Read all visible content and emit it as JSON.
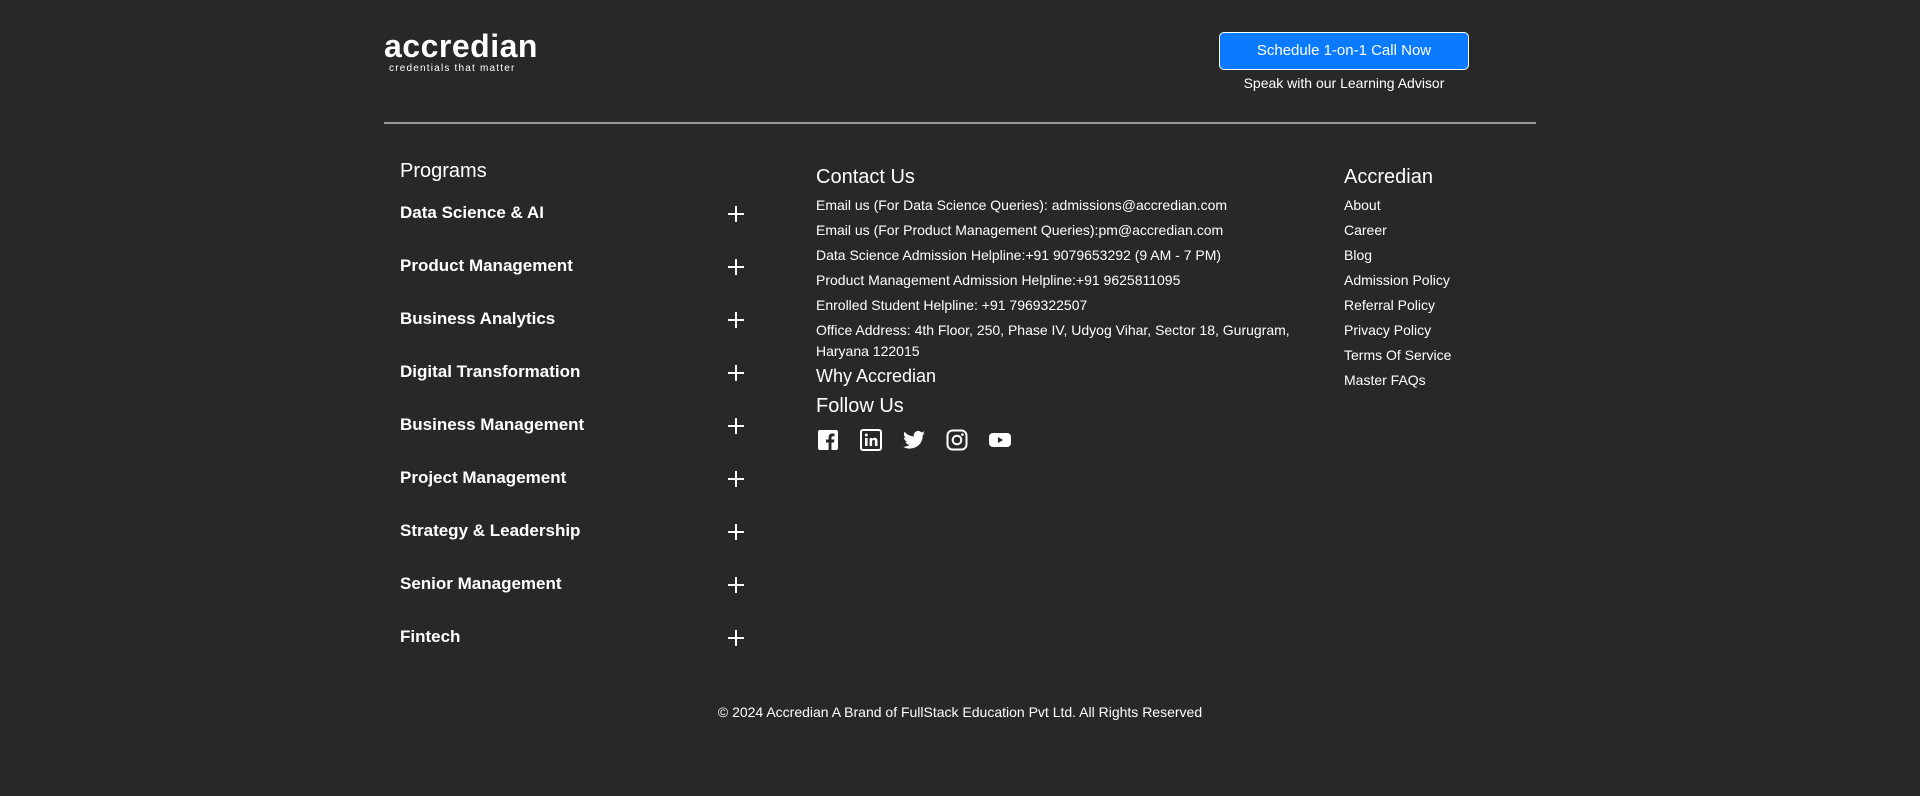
{
  "header": {
    "logo_word": "accredian",
    "logo_tagline": "credentials that matter",
    "cta_label": "Schedule 1-on-1 Call Now",
    "cta_subtext": "Speak with our Learning Advisor"
  },
  "programs": {
    "title": "Programs",
    "items": [
      {
        "label": "Data Science & AI"
      },
      {
        "label": "Product Management"
      },
      {
        "label": "Business Analytics"
      },
      {
        "label": "Digital Transformation"
      },
      {
        "label": "Business Management"
      },
      {
        "label": "Project Management"
      },
      {
        "label": "Strategy & Leadership"
      },
      {
        "label": "Senior Management"
      },
      {
        "label": "Fintech"
      }
    ]
  },
  "contact": {
    "title": "Contact Us",
    "lines": [
      "Email us (For Data Science Queries): admissions@accredian.com",
      "Email us (For Product Management Queries):pm@accredian.com",
      "Data Science Admission Helpline:+91 9079653292 (9 AM - 7 PM)",
      "Product Management Admission Helpline:+91 9625811095",
      "Enrolled Student Helpline: +91 7969322507",
      "Office Address: 4th Floor, 250, Phase IV, Udyog Vihar, Sector 18, Gurugram, Haryana 122015"
    ],
    "why": "Why Accredian",
    "follow": "Follow Us",
    "social_icons": [
      "facebook-icon",
      "linkedin-icon",
      "twitter-icon",
      "instagram-icon",
      "youtube-icon"
    ]
  },
  "accredian": {
    "title": "Accredian",
    "links": [
      "About",
      "Career",
      "Blog",
      "Admission Policy",
      "Referral Policy",
      "Privacy Policy",
      "Terms Of Service",
      "Master FAQs"
    ]
  },
  "footer": {
    "copyright": "© 2024 Accredian A Brand of FullStack Education Pvt Ltd. All Rights Reserved"
  },
  "colors": {
    "background": "#282828",
    "cta_blue": "#0a7bff",
    "text": "#ffffff"
  }
}
